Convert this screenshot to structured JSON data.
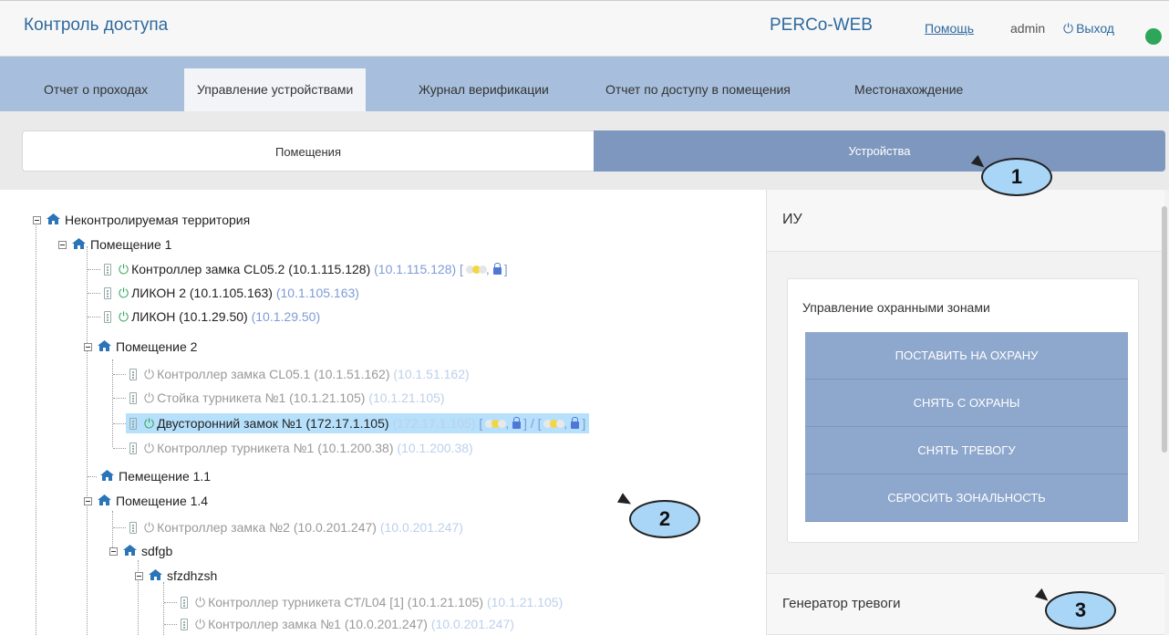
{
  "header": {
    "app_title": "Контроль доступа",
    "brand": "PERCo-WEB",
    "help": "Помощь",
    "user": "admin",
    "logout": "Выход",
    "status_color": "#2ea65a"
  },
  "tabs": [
    "Отчет о проходах",
    "Управление устройствами",
    "Журнал верификации",
    "Отчет по доступу в помещения",
    "Местонахождение"
  ],
  "active_tab": "Управление устройствами",
  "segments": {
    "left": "Помещения",
    "right": "Устройства"
  },
  "callouts": [
    "1",
    "2",
    "3"
  ],
  "tree": {
    "nodes": [
      {
        "type": "room",
        "label": "Неконтролируемая территория"
      },
      {
        "type": "room",
        "label": "Помещение 1"
      },
      {
        "type": "device",
        "label": "Контроллер замка CL05.2 (10.1.115.128)",
        "ip": "(10.1.115.128)",
        "state": "active",
        "indicators": "[ , ]"
      },
      {
        "type": "device",
        "label": "ЛИКОН 2 (10.1.105.163)",
        "ip": "(10.1.105.163)",
        "state": "active"
      },
      {
        "type": "device",
        "label": "ЛИКОН (10.1.29.50)",
        "ip": "(10.1.29.50)",
        "state": "active"
      },
      {
        "type": "room",
        "label": "Помещение 2"
      },
      {
        "type": "device",
        "label": "Контроллер замка CL05.1 (10.1.51.162)",
        "ip": "(10.1.51.162)",
        "state": "inactive"
      },
      {
        "type": "device",
        "label": "Стойка турникета №1 (10.1.21.105)",
        "ip": "(10.1.21.105)",
        "state": "inactive"
      },
      {
        "type": "device",
        "label": "Двусторонний замок №1 (172.17.1.105)",
        "ip": "(172.17.1.105)",
        "state": "active",
        "selected": true,
        "indicators": "[ , ] / [ , ]"
      },
      {
        "type": "device",
        "label": "Контроллер турникета №1 (10.1.200.38)",
        "ip": "(10.1.200.38)",
        "state": "inactive"
      },
      {
        "type": "room",
        "label": "Пемещение 1.1"
      },
      {
        "type": "room",
        "label": "Помещение 1.4"
      },
      {
        "type": "device",
        "label": "Контроллер замка №2 (10.0.201.247)",
        "ip": "(10.0.201.247)",
        "state": "inactive"
      },
      {
        "type": "room",
        "label": "sdfgb"
      },
      {
        "type": "room",
        "label": "sfzdhzsh"
      },
      {
        "type": "device",
        "label": "Контроллер турникета CT/L04 [1] (10.1.21.105)",
        "ip": "(10.1.21.105)",
        "state": "inactive"
      },
      {
        "type": "device",
        "label": "Контроллер замка №1 (10.0.201.247)",
        "ip": "(10.0.201.247)",
        "state": "inactive"
      }
    ]
  },
  "right_panel": {
    "iu_title": "ИУ",
    "zones_title": "Управление охранными зонами",
    "buttons": [
      "ПОСТАВИТЬ НА ОХРАНУ",
      "СНЯТЬ С ОХРАНЫ",
      "СНЯТЬ ТРЕВОГУ",
      "СБРОСИТЬ ЗОНАЛЬНОСТЬ"
    ],
    "alarm_title": "Генератор тревоги"
  }
}
